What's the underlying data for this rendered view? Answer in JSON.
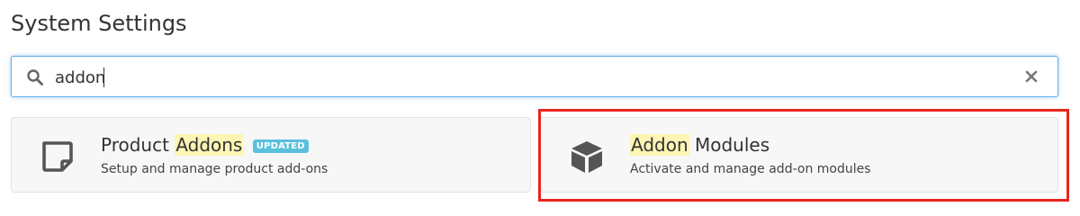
{
  "page": {
    "title": "System Settings"
  },
  "search": {
    "value": "addon",
    "search_icon": "magnifier-icon",
    "clear_icon": "close-icon"
  },
  "results": [
    {
      "title_before": "Product ",
      "title_match": "Addons",
      "title_after": "",
      "badge": "UPDATED",
      "description": "Setup and manage product add-ons",
      "icon": "sticky-note-icon"
    },
    {
      "title_before": "",
      "title_match": "Addon",
      "title_after": " Modules",
      "badge": "",
      "description": "Activate and manage add-on modules",
      "icon": "cube-icon",
      "highlighted": true
    }
  ],
  "colors": {
    "highlight_frame": "#e8261d",
    "match_highlight": "#fdf5b4",
    "badge_bg": "#5bc0de",
    "focus_border": "#66afe9"
  }
}
